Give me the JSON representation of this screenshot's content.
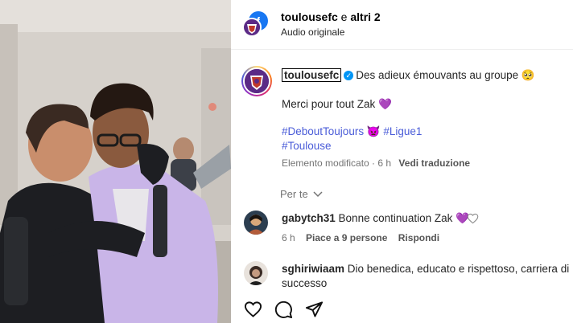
{
  "header": {
    "account": "toulousefc",
    "joiner": " e ",
    "others": "altri 2",
    "audio": "Audio originale"
  },
  "caption": {
    "username": "toulousefc",
    "text": "Des adieux émouvants au groupe 🥺",
    "line2": "Merci pour tout Zak 💜",
    "tags": [
      "#DeboutToujours 👿 ",
      "#Ligue1",
      "#Toulouse"
    ],
    "edited": "Elemento modificato · 6 h",
    "translate": "Vedi traduzione"
  },
  "for_you": "Per te",
  "comments": [
    {
      "username": "gabytch31",
      "text": "Bonne continuation Zak 💜",
      "time": "6 h",
      "likes": "Piace a 9 persone",
      "reply": "Rispondi"
    },
    {
      "username": "sghiriwiaam",
      "text_line1": "Dio benedica, educato e rispettoso, carriera di",
      "text_line2": "successo"
    }
  ],
  "actions": {
    "like": "heart-icon",
    "comment": "comment-icon",
    "share": "share-icon"
  },
  "colors": {
    "link": "#4a5cd8",
    "verified": "#0095f6",
    "muted": "#737373"
  }
}
